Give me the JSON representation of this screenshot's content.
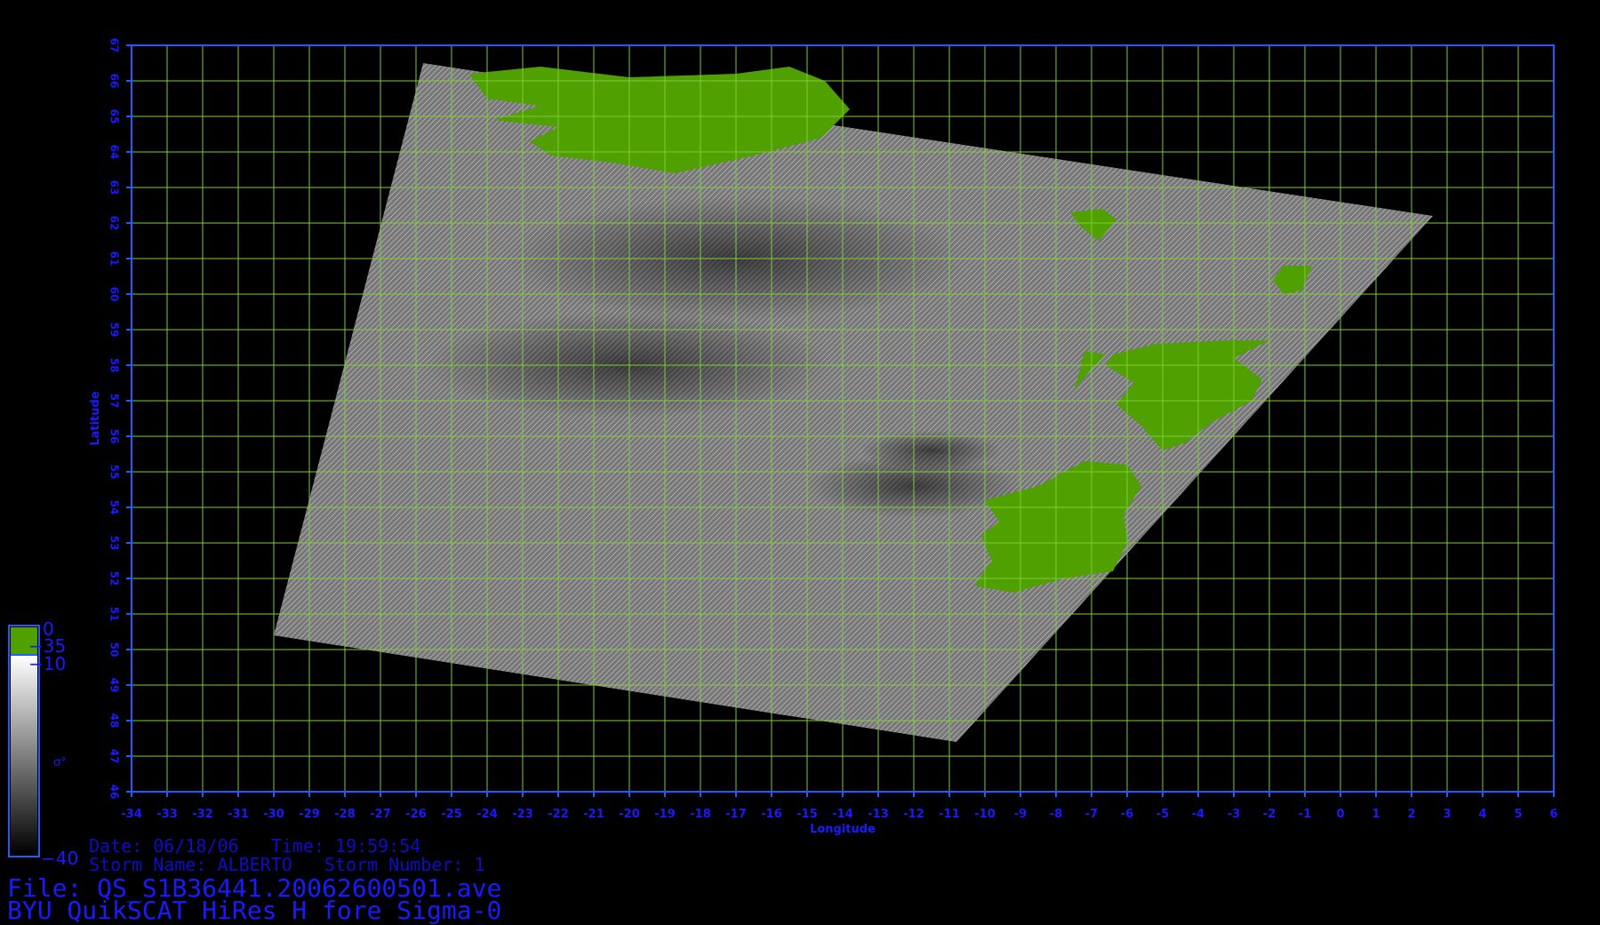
{
  "map": {
    "xlabel": "Longitude",
    "ylabel": "Latitude",
    "lon_ticks": [
      -34,
      -33,
      -32,
      -31,
      -30,
      -29,
      -28,
      -27,
      -26,
      -25,
      -24,
      -23,
      -22,
      -21,
      -20,
      -19,
      -18,
      -17,
      -16,
      -15,
      -14,
      -13,
      -12,
      -11,
      -10,
      -9,
      -8,
      -7,
      -6,
      -5,
      -4,
      -3,
      -2,
      -1,
      0,
      1,
      2,
      3,
      4,
      5,
      6
    ],
    "lat_ticks": [
      46,
      47,
      48,
      49,
      50,
      51,
      52,
      53,
      54,
      55,
      56,
      57,
      58,
      59,
      60,
      61,
      62,
      63,
      64,
      65,
      66,
      67
    ],
    "lon_range": [
      -34,
      6
    ],
    "lat_range": [
      46,
      67
    ],
    "swath_corners_lonlat": [
      [
        -25.8,
        66.5
      ],
      [
        2.6,
        62.2
      ],
      [
        -10.8,
        47.4
      ],
      [
        -30.0,
        50.4
      ]
    ],
    "land_color": "#4fa000",
    "grid_color": "#7ccc3a",
    "frame_color": "#1e5cff",
    "label_color": "#1a1aff"
  },
  "colorbar": {
    "symbol": "σ°",
    "labels": {
      "top": "0",
      "upper": "−35",
      "mid": "−10",
      "bottom": "−40"
    },
    "land_color": "#4fa000"
  },
  "footer": {
    "date_line": "Date: 06/18/06   Time: 19:59:54",
    "storm_line": "Storm Name: ALBERTO   Storm Number: 1",
    "file_line": "File: QS_S1B36441.20062600501.ave",
    "product_line": "BYU QuikSCAT HiRes H fore Sigma-0"
  }
}
